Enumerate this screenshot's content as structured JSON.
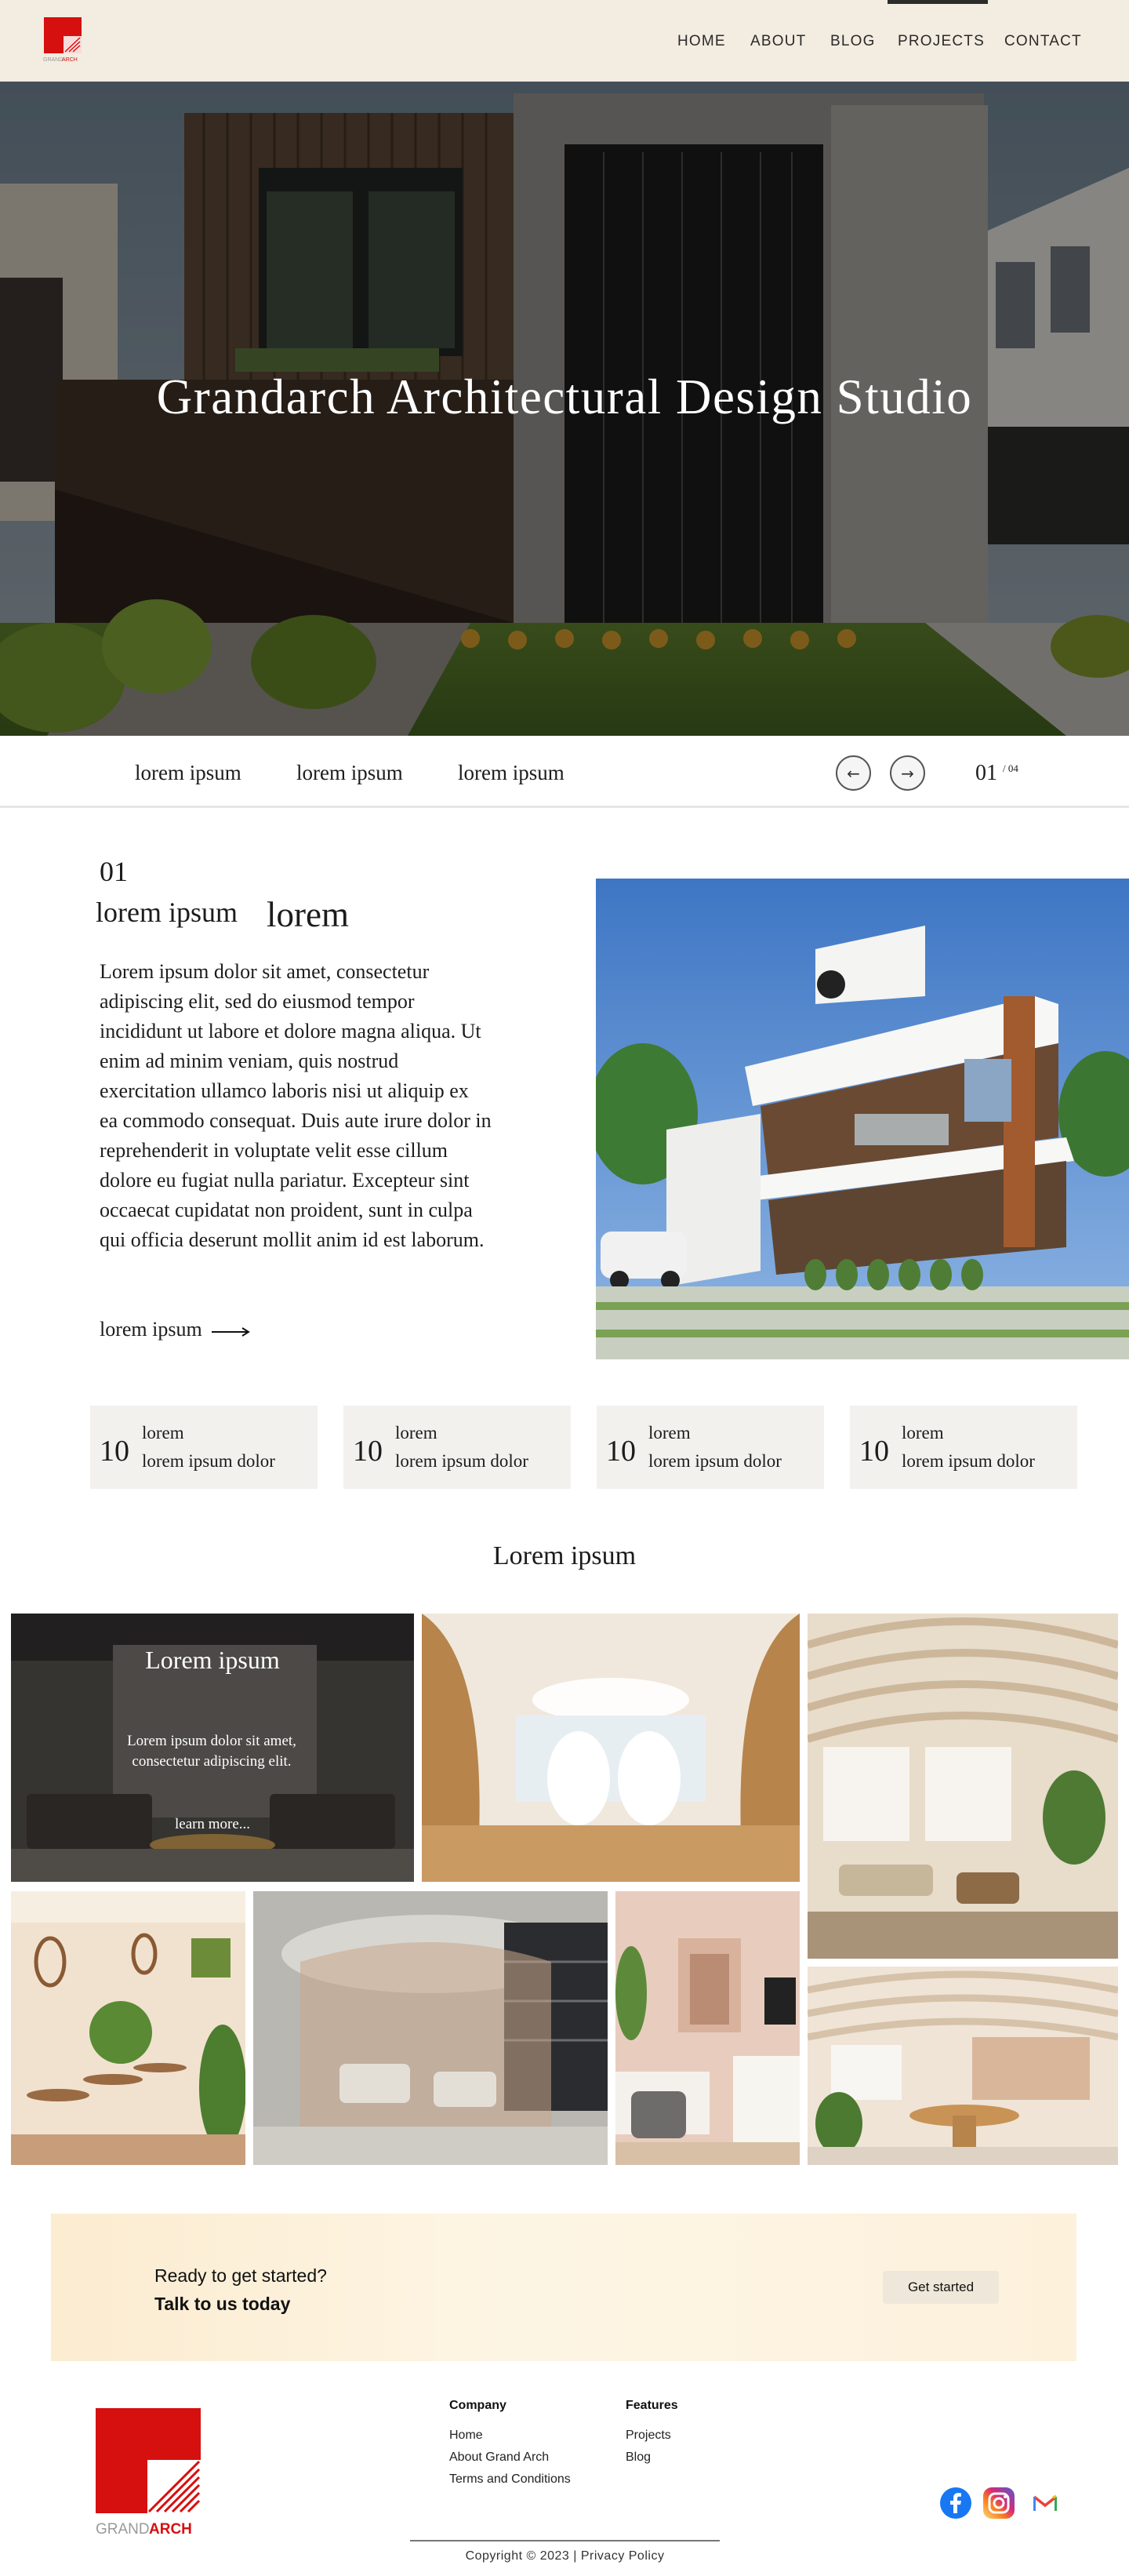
{
  "brand": {
    "logo_text_a": "GRAND",
    "logo_text_b": "ARCH",
    "accent": "#d60f0f"
  },
  "nav": {
    "items": [
      "HOME",
      "ABOUT",
      "BLOG",
      "PROJECTS",
      "CONTACT"
    ],
    "active": "PROJECTS"
  },
  "hero": {
    "title": "Grandarch Architectural Design Studio"
  },
  "tabs": {
    "items": [
      "lorem ipsum",
      "lorem ipsum",
      "lorem ipsum"
    ],
    "prev_icon": "arrow-left-icon",
    "next_icon": "arrow-right-icon",
    "prev_glyph": "←",
    "next_glyph": "→",
    "current": "01",
    "total": "/ 04"
  },
  "intro": {
    "number": "01",
    "heading_a": "lorem ipsum",
    "heading_b": "lorem",
    "body": "Lorem ipsum dolor sit amet, consectetur adipiscing elit, sed do eiusmod tempor incididunt ut labore et dolore magna aliqua. Ut enim ad minim veniam, quis nostrud exercitation ullamco laboris nisi ut aliquip ex ea commodo consequat. Duis aute irure dolor in reprehenderit in voluptate velit esse cillum dolore eu fugiat nulla pariatur. Excepteur sint occaecat cupidatat non proident, sunt in culpa qui officia deserunt mollit anim id est laborum.",
    "link": "lorem ipsum"
  },
  "stats": [
    {
      "number": "10",
      "line1": "lorem",
      "line2": "lorem ipsum dolor"
    },
    {
      "number": "10",
      "line1": "lorem",
      "line2": "lorem ipsum dolor"
    },
    {
      "number": "10",
      "line1": "lorem",
      "line2": "lorem ipsum dolor"
    },
    {
      "number": "10",
      "line1": "lorem",
      "line2": "lorem ipsum dolor"
    }
  ],
  "gallery": {
    "title": "Lorem ipsum",
    "overlay_title": "Lorem ipsum",
    "overlay_text": "Lorem ipsum dolor sit amet, consectetur adipiscing elit.",
    "overlay_link": "learn more..."
  },
  "cta": {
    "line1": "Ready to get started?",
    "line2": "Talk to us today",
    "button": "Get started"
  },
  "footer": {
    "company_heading": "Company",
    "company_links": [
      "Home",
      "About Grand Arch",
      "Terms and Conditions"
    ],
    "features_heading": "Features",
    "features_links": [
      "Projects",
      "Blog"
    ],
    "copyright": "Copyright © 2023 | Privacy Policy",
    "social": [
      "facebook-icon",
      "instagram-icon",
      "gmail-icon"
    ]
  }
}
